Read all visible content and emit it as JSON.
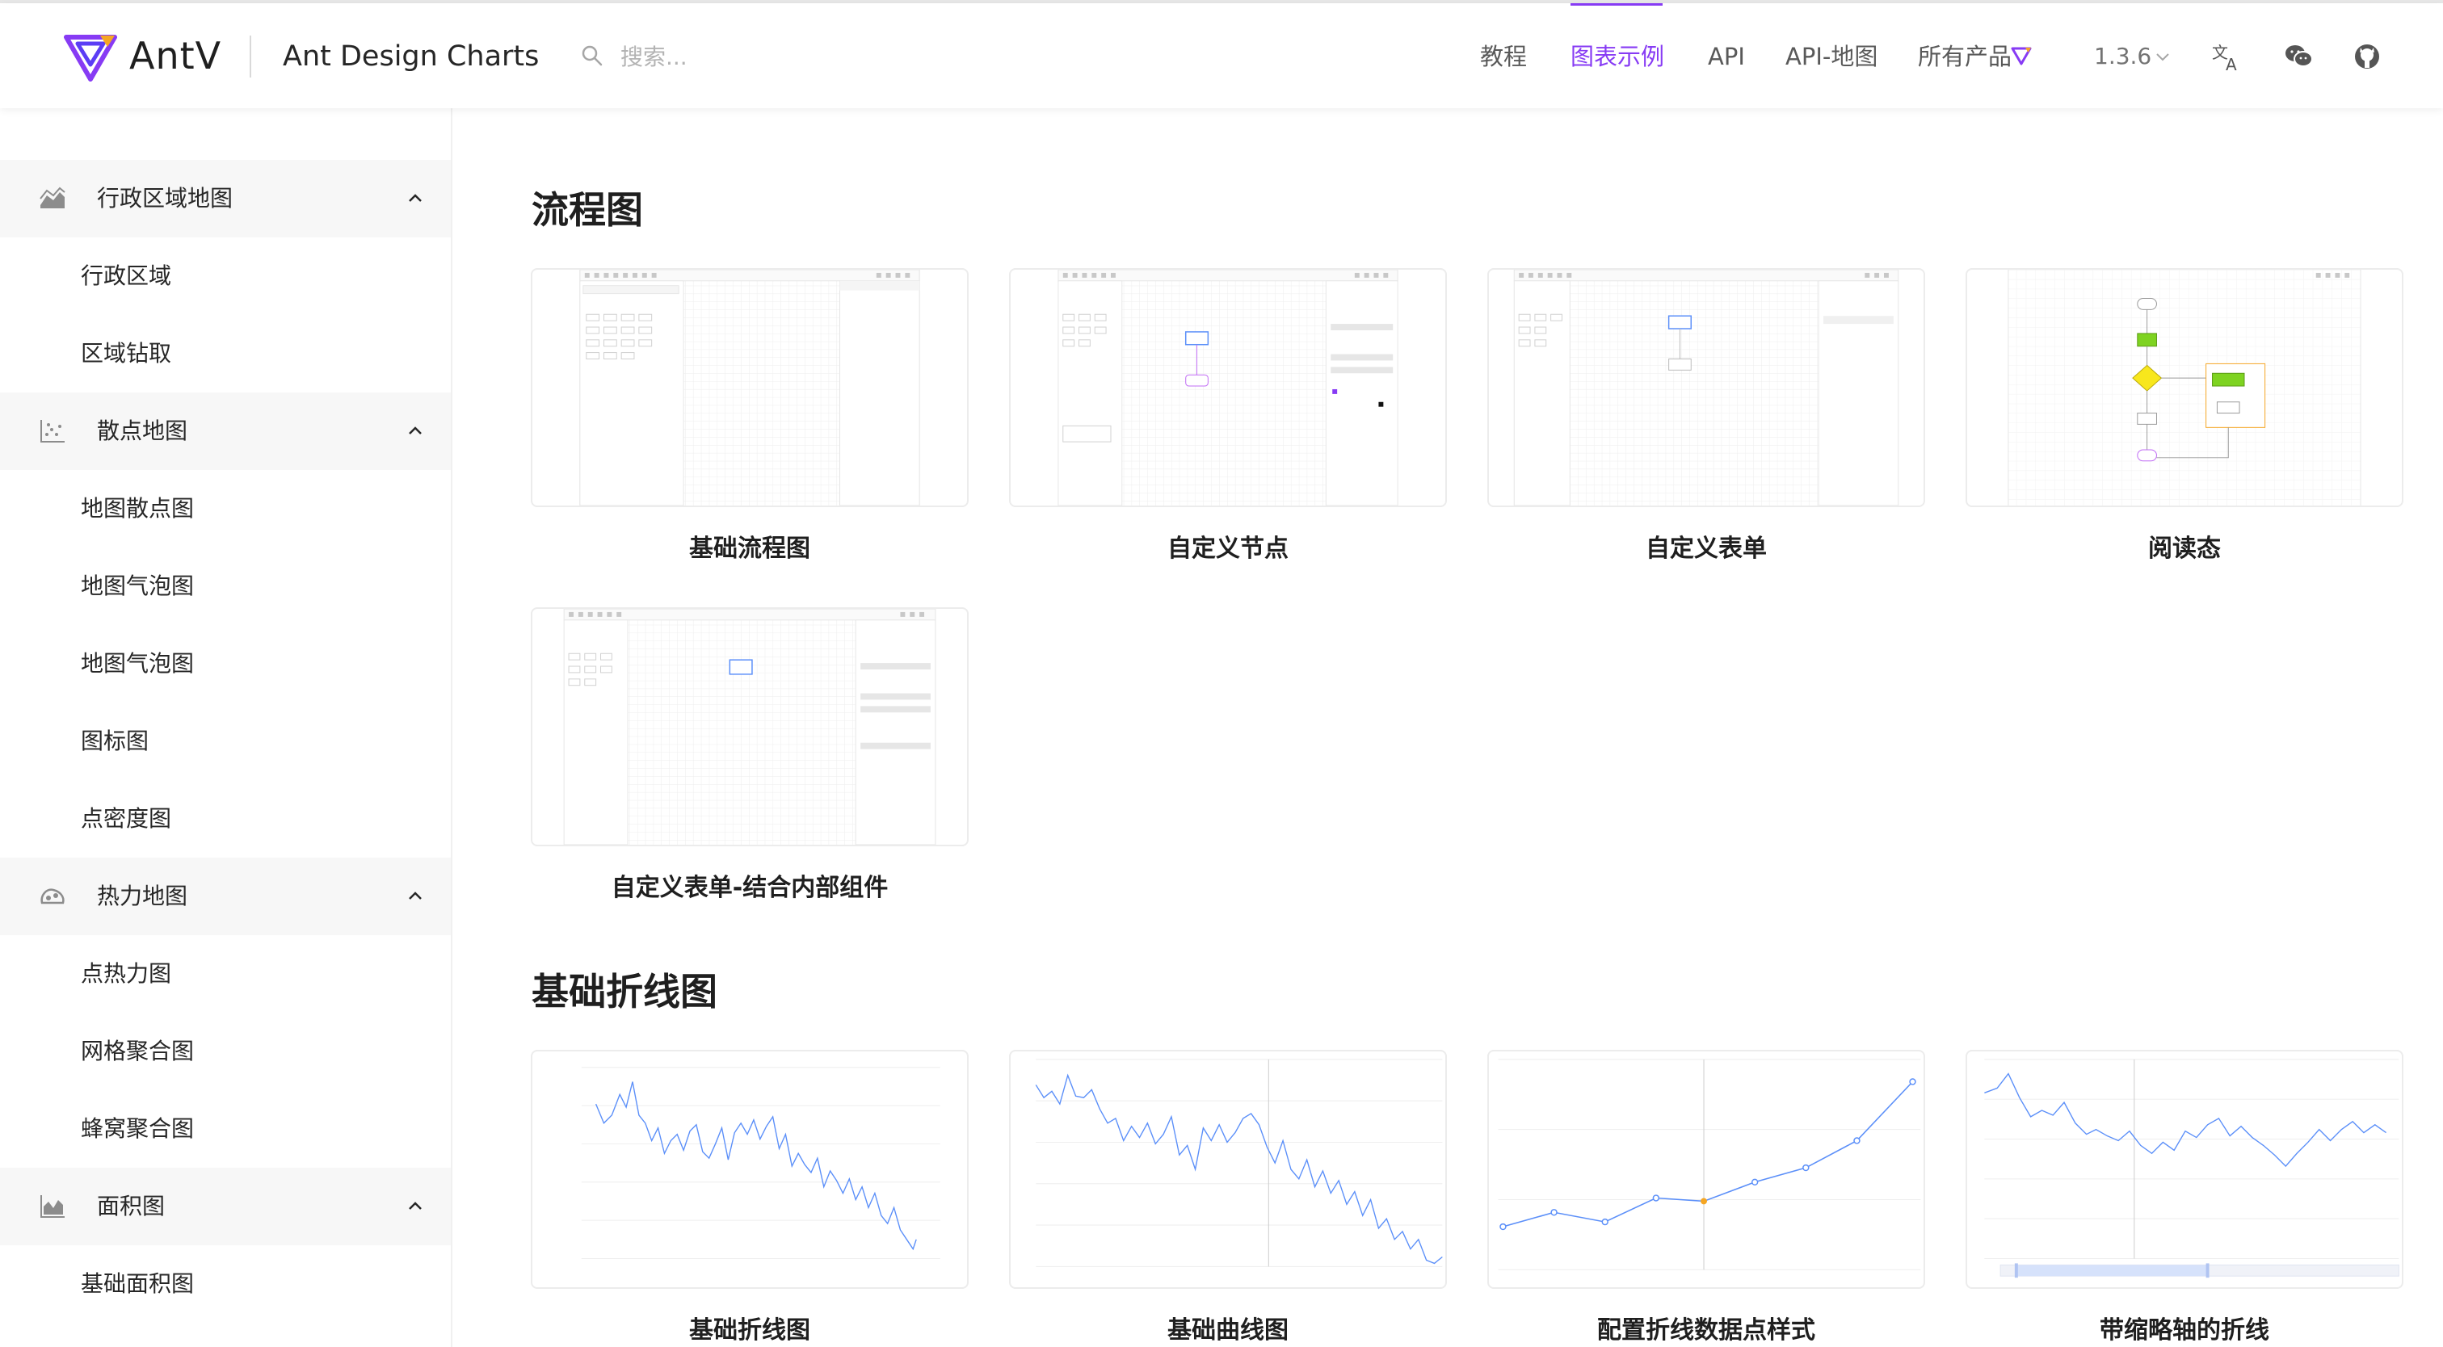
{
  "header": {
    "brand": "AntV",
    "product": "Ant Design Charts",
    "search_placeholder": "搜索...",
    "nav": [
      {
        "label": "教程"
      },
      {
        "label": "图表示例",
        "active": true
      },
      {
        "label": "API"
      },
      {
        "label": "API-地图"
      },
      {
        "label": "所有产品"
      }
    ],
    "version": "1.3.6",
    "icons": [
      "translate-icon",
      "wechat-icon",
      "github-icon"
    ],
    "accent_color": "#873bf4"
  },
  "sidebar": {
    "groups": [
      {
        "title": "行政区域地图",
        "icon": "area-map-icon",
        "items": [
          "行政区域",
          "区域钻取"
        ]
      },
      {
        "title": "散点地图",
        "icon": "scatter-map-icon",
        "items": [
          "地图散点图",
          "地图气泡图",
          "地图气泡图",
          "图标图",
          "点密度图"
        ]
      },
      {
        "title": "热力地图",
        "icon": "heat-map-icon",
        "items": [
          "点热力图",
          "网格聚合图",
          "蜂窝聚合图"
        ]
      },
      {
        "title": "面积图",
        "icon": "area-chart-icon",
        "items": [
          "基础面积图"
        ]
      }
    ]
  },
  "main": {
    "sections": [
      {
        "title": "流程图",
        "cards": [
          {
            "title": "基础流程图"
          },
          {
            "title": "自定义节点"
          },
          {
            "title": "自定义表单"
          },
          {
            "title": "阅读态"
          },
          {
            "title": "自定义表单-结合内部组件"
          }
        ]
      },
      {
        "title": "基础折线图",
        "cards": [
          {
            "title": "基础折线图"
          },
          {
            "title": "基础曲线图"
          },
          {
            "title": "配置折线数据点样式"
          },
          {
            "title": "带缩略轴的折线"
          }
        ]
      }
    ]
  }
}
